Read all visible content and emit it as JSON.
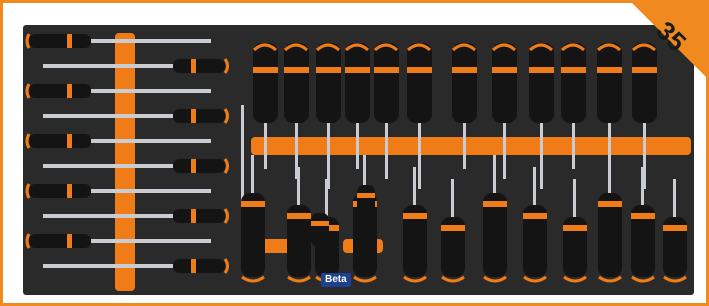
{
  "image": {
    "subject": "black-foam-tool-tray-with-screwdrivers",
    "badge": {
      "label": "35",
      "color": "#f08a1e"
    },
    "brand_label": "Beta",
    "colors": {
      "frame": "#f08a1e",
      "foam": "#2a2a2a",
      "accent_orange": "#f07c18",
      "handle_black": "#141414",
      "steel": "#c9ccd1"
    }
  }
}
